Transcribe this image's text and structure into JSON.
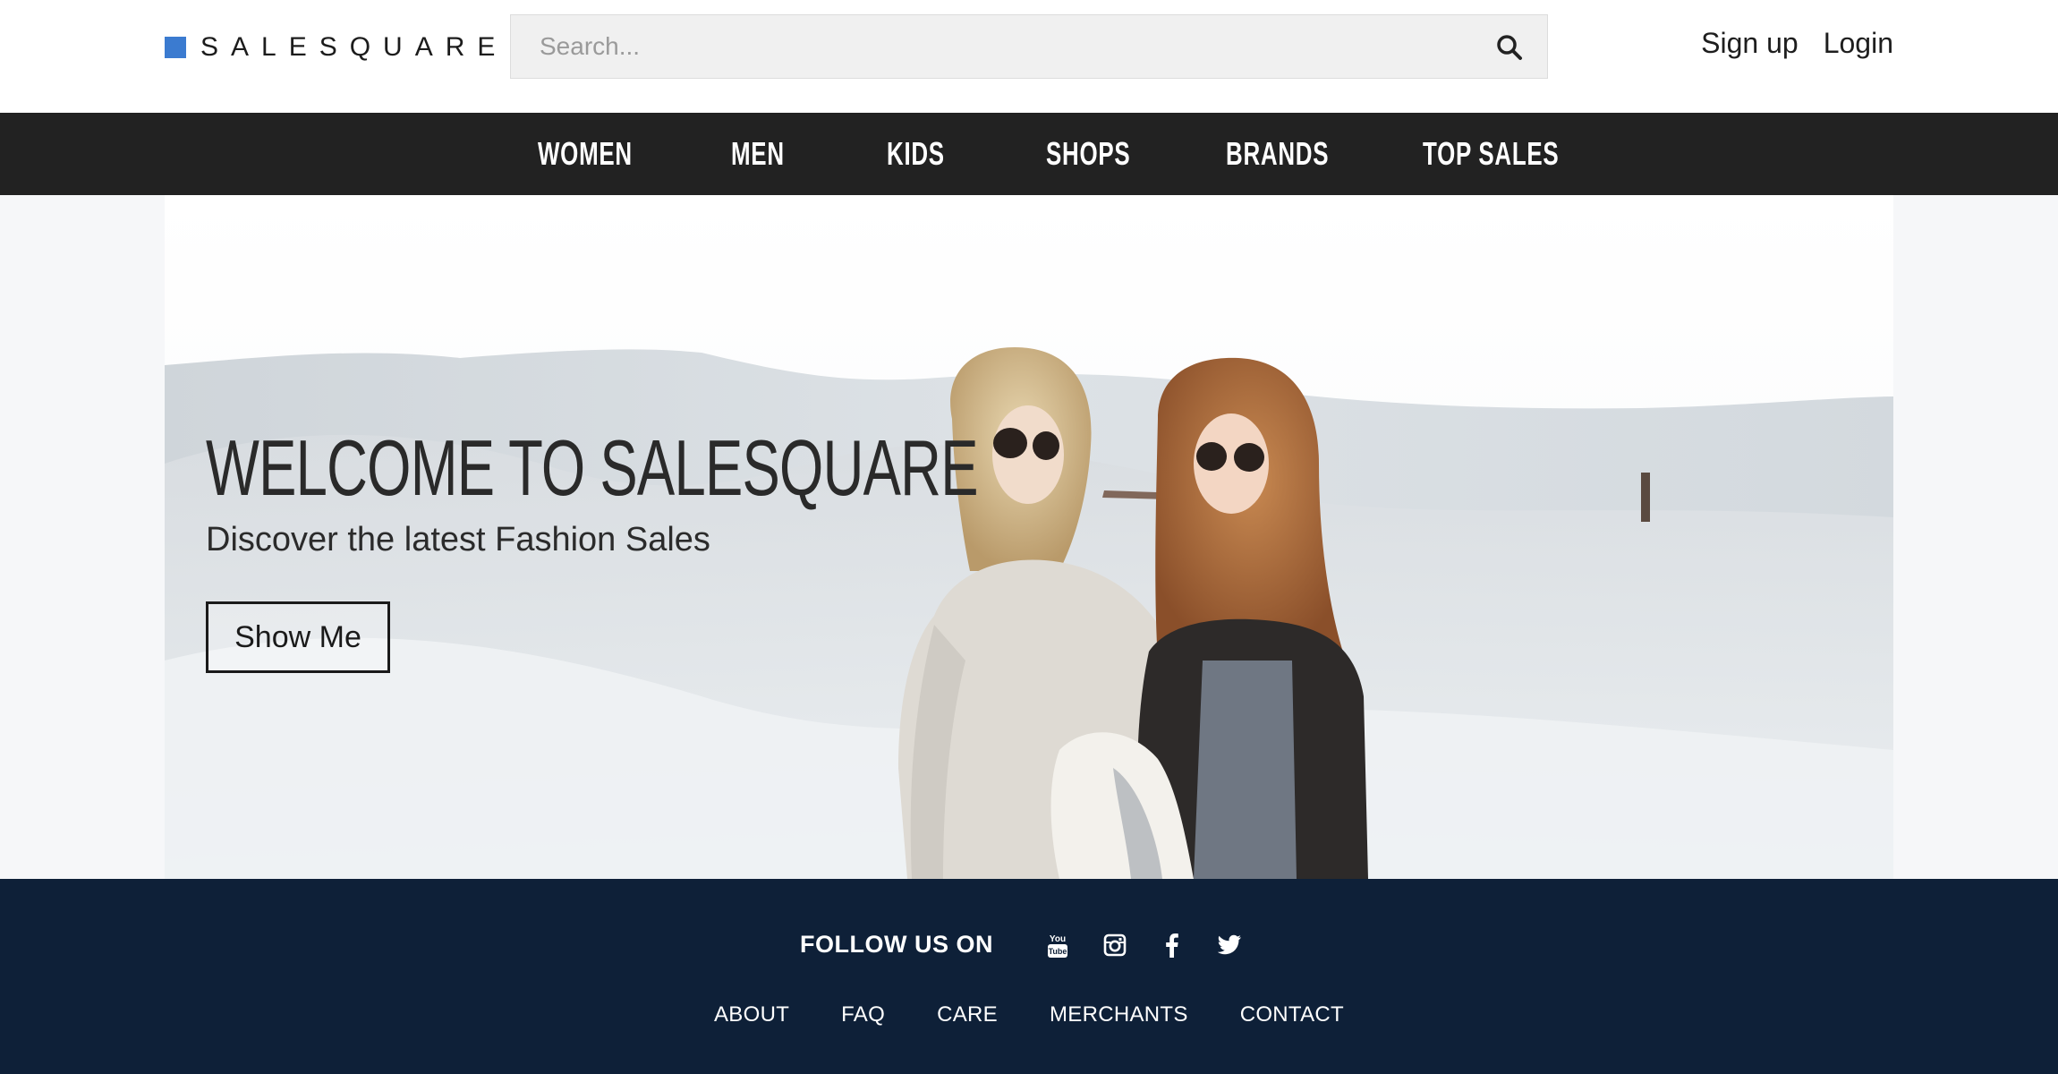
{
  "brand": {
    "name": "SALESQUARE",
    "accent_color": "#3b7bd0"
  },
  "search": {
    "placeholder": "Search...",
    "icon": "search-icon"
  },
  "auth": {
    "signup_label": "Sign up",
    "login_label": "Login"
  },
  "nav": {
    "items": [
      {
        "label": "WOMEN"
      },
      {
        "label": "MEN"
      },
      {
        "label": "KIDS"
      },
      {
        "label": "SHOPS"
      },
      {
        "label": "BRANDS"
      },
      {
        "label": "TOP SALES"
      }
    ]
  },
  "hero": {
    "title": "WELCOME TO SALESQUARE",
    "subtitle": "Discover the latest Fashion Sales",
    "cta_label": "Show Me"
  },
  "footer": {
    "follow_label": "FOLLOW US ON",
    "social": [
      {
        "name": "youtube-icon"
      },
      {
        "name": "instagram-icon"
      },
      {
        "name": "facebook-icon"
      },
      {
        "name": "twitter-icon"
      }
    ],
    "links": [
      {
        "label": "ABOUT"
      },
      {
        "label": "FAQ"
      },
      {
        "label": "CARE"
      },
      {
        "label": "MERCHANTS"
      },
      {
        "label": "CONTACT"
      }
    ],
    "background_color": "#0e2038"
  }
}
